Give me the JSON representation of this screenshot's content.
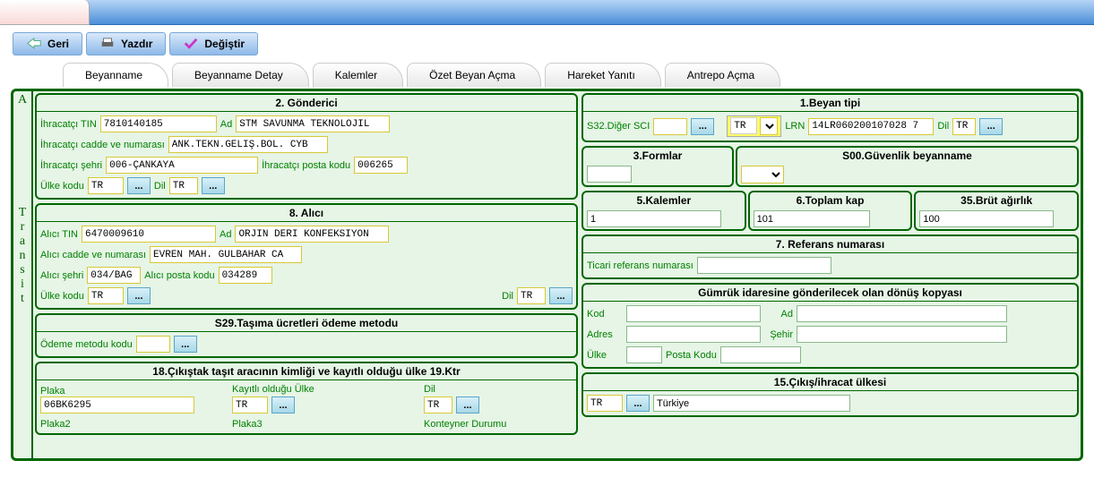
{
  "toolbar": {
    "back": "Geri",
    "print": "Yazdır",
    "change": "Değiştir"
  },
  "tabs": [
    "Beyanname",
    "Beyanname Detay",
    "Kalemler",
    "Özet Beyan Açma",
    "Hareket Yanıtı",
    "Antrepo Açma"
  ],
  "vlabel": [
    "A",
    "T",
    "r",
    "a",
    "n",
    "s",
    "i",
    "t"
  ],
  "gonderici": {
    "title": "2. Gönderici",
    "tin_l": "İhracatçı TIN",
    "tin": "7810140185",
    "ad_l": "Ad",
    "ad": "STM SAVUNMA TEKNOLOJİL",
    "cadde_l": "İhracatçı cadde ve numarası",
    "cadde": "ANK.TEKN.GELİŞ.BÖL. CYB",
    "sehir_l": "İhracatçı şehri",
    "sehir": "006-ÇANKAYA",
    "posta_l": "İhracatçı posta kodu",
    "posta": "006265",
    "ulke_l": "Ülke kodu",
    "ulke": "TR",
    "dil_l": "Dil",
    "dil": "TR"
  },
  "alici": {
    "title": "8. Alıcı",
    "tin_l": "Alıcı TIN",
    "tin": "6470009610",
    "ad_l": "Ad",
    "ad": "ORJİN DERİ KONFEKSİYON",
    "cadde_l": "Alıcı cadde ve numarası",
    "cadde": "EVREN MAH. GÜLBAHAR CA",
    "sehir_l": "Alıcı şehri",
    "sehir": "034/BAĞ",
    "posta_l": "Alıcı posta kodu",
    "posta": "034289",
    "ulke_l": "Ülke kodu",
    "ulke": "TR",
    "dil_l": "Dil",
    "dil": "TR"
  },
  "s29": {
    "title": "S29.Taşıma ücretleri ödeme metodu",
    "kod_l": "Ödeme metodu kodu",
    "kod": ""
  },
  "s18": {
    "title": "18.Çıkıştak taşıt aracının kimliği ve kayıtlı olduğu ülke 19.Ktr",
    "plaka_l": "Plaka",
    "plaka": "06BK6295",
    "ulke_l": "Kayıtlı olduğu Ülke",
    "ulke": "TR",
    "dil_l": "Dil",
    "dil": "TR",
    "plaka2_l": "Plaka2",
    "plaka3_l": "Plaka3",
    "kont_l": "Konteyner Durumu"
  },
  "beyan": {
    "title": "1.Beyan tipi",
    "s32_l": "S32.Diğer SCI",
    "s32": "",
    "tr": "TR",
    "lrn_l": "LRN",
    "lrn": "14LR060200107028 7",
    "dil_l": "Dil",
    "dil": "TR"
  },
  "formlar": {
    "l3": "3.Formlar",
    "s00": "S00.Güvenlik beyanname"
  },
  "kalemler": {
    "l": "5.Kalemler",
    "v": "1"
  },
  "kap": {
    "l": "6.Toplam kap",
    "v": "101"
  },
  "brut": {
    "l": "35.Brüt ağırlık",
    "v": "100"
  },
  "ref": {
    "title": "7. Referans numarası",
    "l": "Ticari referans numarası",
    "v": ""
  },
  "donus": {
    "title": "Gümrük idaresine gönderilecek olan dönüş kopyası",
    "kod_l": "Kod",
    "ad_l": "Ad",
    "adres_l": "Adres",
    "sehir_l": "Şehir",
    "ulke_l": "Ülke",
    "posta_l": "Posta Kodu"
  },
  "cikis": {
    "title": "15.Çıkış/ihracat ülkesi",
    "ulke": "TR",
    "ad": "Türkiye"
  },
  "dots": "..."
}
